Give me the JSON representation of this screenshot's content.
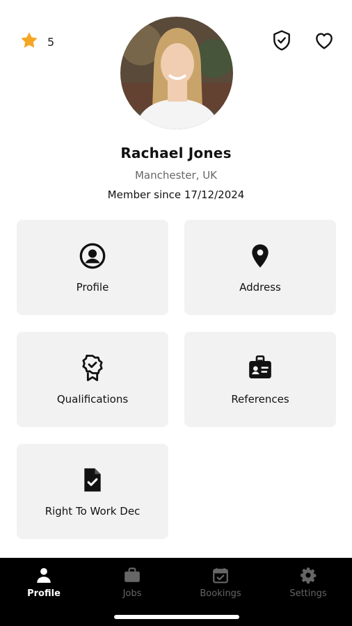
{
  "profile": {
    "rating": "5",
    "name": "Rachael Jones",
    "location": "Manchester, UK",
    "member_since": "Member since 17/12/2024"
  },
  "colors": {
    "star": "#f5a623",
    "card_bg": "#f2f2f2",
    "nav_bg": "#000000"
  },
  "cards": [
    {
      "label": "Profile",
      "icon": "user-circle-icon"
    },
    {
      "label": "Address",
      "icon": "location-pin-icon"
    },
    {
      "label": "Qualifications",
      "icon": "award-badge-icon"
    },
    {
      "label": "References",
      "icon": "id-badge-icon"
    },
    {
      "label": "Right To Work Dec",
      "icon": "document-check-icon"
    }
  ],
  "nav": [
    {
      "label": "Profile",
      "icon": "person-icon",
      "active": true
    },
    {
      "label": "Jobs",
      "icon": "briefcase-icon",
      "active": false
    },
    {
      "label": "Bookings",
      "icon": "calendar-check-icon",
      "active": false
    },
    {
      "label": "Settings",
      "icon": "gear-icon",
      "active": false
    }
  ]
}
